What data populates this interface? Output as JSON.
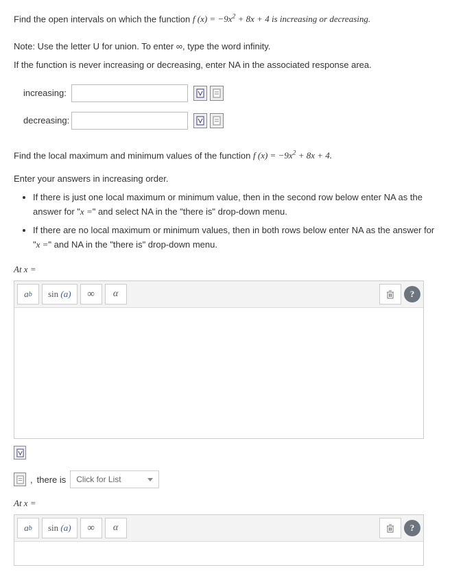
{
  "q1": {
    "prefix": "Find the open intervals on which the function ",
    "func": "f (x) = −9x",
    "sup": "2",
    "suffix": " + 8x + 4 is increasing or decreasing.",
    "note1": "Note: Use the letter U for union. To enter ∞, type the word infinity.",
    "note2": "If the function is never increasing or decreasing, enter NA in the associated response area."
  },
  "inputs": {
    "increasing_label": "increasing:",
    "decreasing_label": "decreasing:",
    "increasing_value": "",
    "decreasing_value": ""
  },
  "q2": {
    "prefix": "Find the local maximum and minimum values of the function ",
    "func": "f (x) = −9x",
    "sup": "2",
    "suffix": " + 8x + 4."
  },
  "instructions": {
    "header": "Enter your answers in increasing order.",
    "b1a": "If there is just one local maximum or minimum value, then in the second row below enter NA as the answer for \"",
    "b1_math": "x =",
    "b1b": "\"  and select NA in the \"there is\" drop-down menu.",
    "b2a": "If there are no local maximum or minimum values, then in both rows below enter NA as the answer for \"",
    "b2_math": "x =",
    "b2b": "\" and NA in the \"there is\" drop-down menu."
  },
  "editor": {
    "at_label": "At x =",
    "ab_a": "a",
    "ab_b": "b",
    "sin_label": "sin",
    "sin_arg": "(a)",
    "inf": "∞",
    "alpha": "α",
    "help": "?",
    "comma": ", ",
    "there_is": "there is",
    "dropdown_placeholder": "Click for List"
  }
}
